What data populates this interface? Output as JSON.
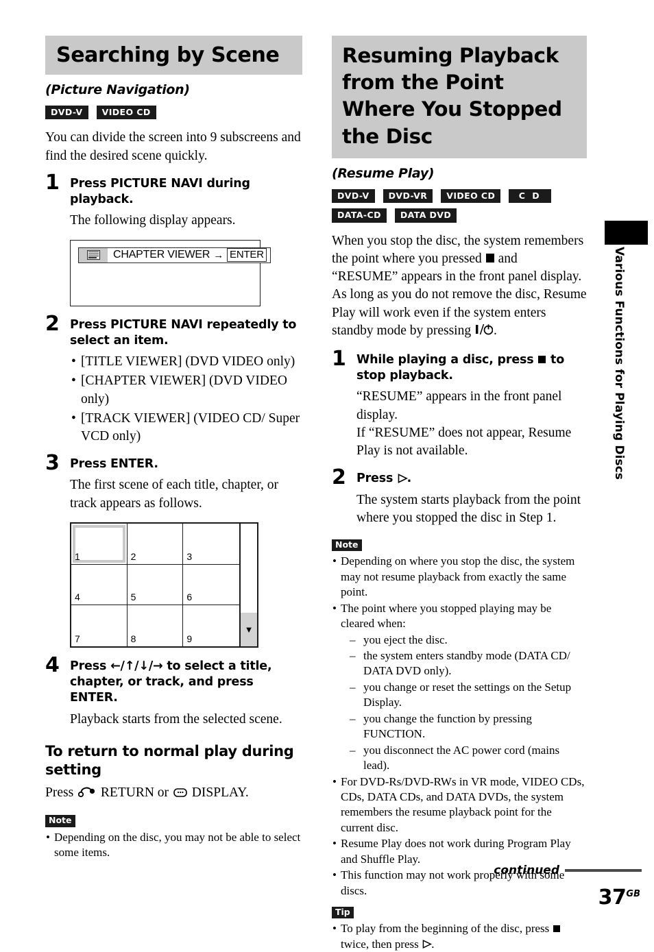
{
  "page": {
    "number": "37",
    "region_suffix": "GB",
    "continued_label": "continued",
    "side_tab_label": "Various Functions for Playing Discs"
  },
  "left_column": {
    "heading": "Searching by Scene",
    "subheading": "(Picture Navigation)",
    "badges": [
      "DVD-V",
      "VIDEO CD"
    ],
    "intro": "You can divide the screen into 9 subscreens and find the desired scene quickly.",
    "steps": [
      {
        "number": "1",
        "title": "Press PICTURE NAVI during playback.",
        "text": "The following display appears."
      },
      {
        "number": "2",
        "title": "Press PICTURE NAVI repeatedly to select an item.",
        "bullets": [
          "[TITLE VIEWER] (DVD VIDEO only)",
          "[CHAPTER VIEWER] (DVD VIDEO only)",
          "[TRACK VIEWER] (VIDEO CD/ Super VCD only)"
        ]
      },
      {
        "number": "3",
        "title": "Press ENTER.",
        "text": "The first scene of each title, chapter, or track appears as follows."
      },
      {
        "number": "4",
        "title_pre": "Press ",
        "title_arrows": "←/↑/↓/→",
        "title_post": " to select a title, chapter, or track, and press ENTER.",
        "text": "Playback starts from the selected scene."
      }
    ],
    "osd": {
      "icon_name": "chapter-viewer-icon",
      "label": "CHAPTER VIEWER",
      "arrow": "→",
      "enter_label": "ENTER"
    },
    "scene_grid": {
      "cells": [
        "1",
        "2",
        "3",
        "4",
        "5",
        "6",
        "7",
        "8",
        "9"
      ],
      "selected_index": 0,
      "scroll_arrow": "▼"
    },
    "return_heading": "To return to normal play during setting",
    "return_text_pre": "Press ",
    "return_text_mid": " RETURN or ",
    "return_text_post": " DISPLAY.",
    "note_tag": "Note",
    "notes": [
      "Depending on the disc, you may not be able to select some items."
    ]
  },
  "right_column": {
    "heading": "Resuming Playback from the Point Where You Stopped the Disc",
    "subheading": "(Resume Play)",
    "badges": [
      "DVD-V",
      "DVD-VR",
      "VIDEO CD",
      "C D",
      "DATA-CD",
      "DATA DVD"
    ],
    "intro_part1": "When you stop the disc, the system remembers the point where you pressed ",
    "intro_part2": " and “RESUME” appears in the front panel display. As long as you do not remove the disc, Resume Play will work even if the system enters standby mode by pressing ",
    "intro_part3": ".",
    "steps": [
      {
        "number": "1",
        "title_pre": "While playing a disc, press ",
        "title_post": " to stop playback.",
        "text_lines": [
          "“RESUME” appears in the front panel display.",
          "If “RESUME” does not appear, Resume Play is not available."
        ]
      },
      {
        "number": "2",
        "title_pre": "Press ",
        "title_post": ".",
        "text_lines": [
          "The system starts playback from the point where you stopped the disc in Step 1."
        ]
      }
    ],
    "note_tag": "Note",
    "notes": [
      "Depending on where you stop the disc, the system may not resume playback from exactly the same point.",
      "The point where you stopped playing may be cleared when:"
    ],
    "note_sub_items": [
      "you eject the disc.",
      "the system enters standby mode (DATA CD/ DATA DVD only).",
      "you change or reset the settings on the Setup Display.",
      "you change the function by pressing FUNCTION.",
      "you disconnect the AC power cord (mains lead)."
    ],
    "notes_rest": [
      "For DVD-Rs/DVD-RWs in VR mode, VIDEO CDs, CDs, DATA CDs, and DATA DVDs, the system remembers the resume playback point for the current disc.",
      "Resume Play does not work during Program Play and Shuffle Play.",
      "This function may not work properly with some discs."
    ],
    "tip_tag": "Tip",
    "tip_part1": "To play from the beginning of the disc, press ",
    "tip_part2": " twice, then press ",
    "tip_part3": "."
  },
  "colors": {
    "heading_bg": "#c9c9c9",
    "badge_bg": "#1b1b1b",
    "ink": "#000000"
  }
}
